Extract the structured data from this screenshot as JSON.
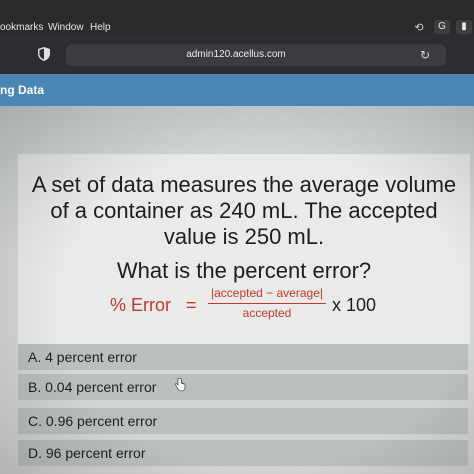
{
  "menubar": {
    "items": [
      "ookmarks",
      "Window",
      "Help"
    ],
    "tray": {
      "swirl_icon": "swirl-icon",
      "g_badge": "G",
      "battery_icon": "battery-icon"
    }
  },
  "browser": {
    "url": "admin120.acellus.com",
    "shield_icon": "shield-icon",
    "reload_icon": "reload-icon"
  },
  "header": {
    "title": "ng Data",
    "color": "#4a86b4"
  },
  "question": {
    "lines": [
      "A set of data measures the average volume",
      "of a container as 240 mL. The accepted",
      "value is 250 mL."
    ],
    "prompt": "What is the percent error?",
    "formula": {
      "lhs": "% Error",
      "equals": "=",
      "numerator": "|accepted − average|",
      "denominator": "accepted",
      "multiplier": "x 100",
      "color": "#c0392b"
    }
  },
  "choices": [
    {
      "label": "A. 4 percent error"
    },
    {
      "label": "B. 0.04 percent error"
    },
    {
      "label": "C. 0.96 percent error"
    },
    {
      "label": "D. 96 percent error"
    }
  ],
  "cursor_icon": "hand-pointer-icon"
}
